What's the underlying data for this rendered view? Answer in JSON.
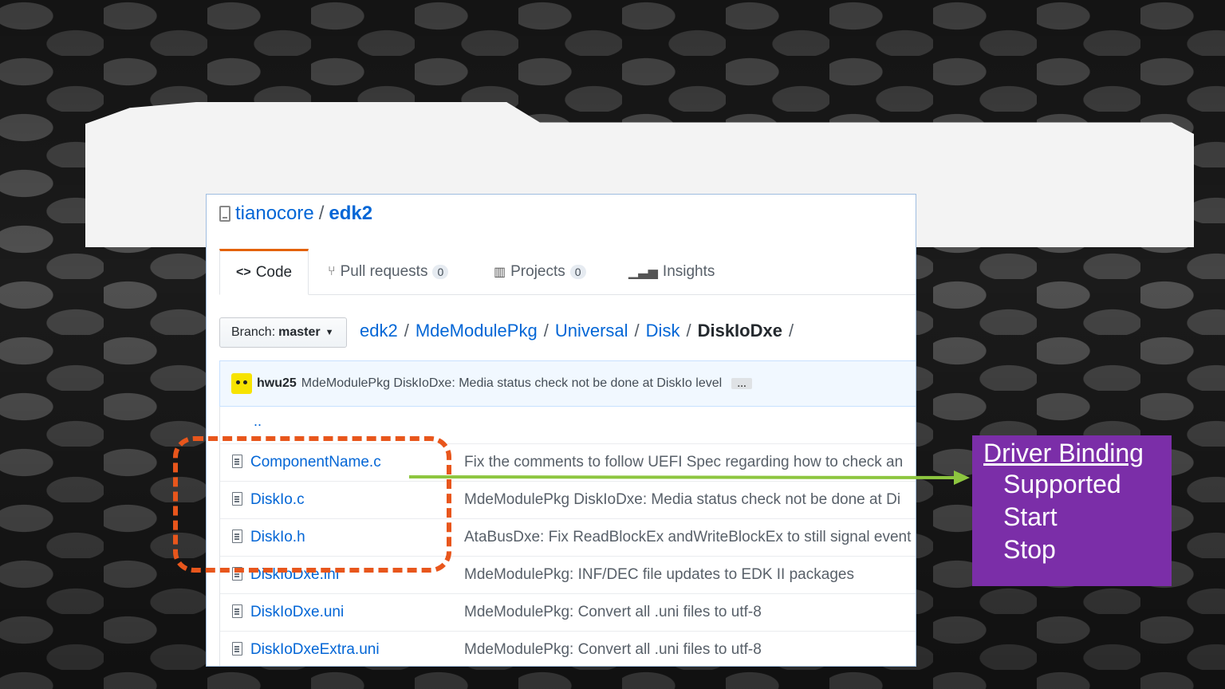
{
  "repo": {
    "owner": "tianocore",
    "name": "edk2",
    "separator": "/"
  },
  "tabs": [
    {
      "label": "Code",
      "icon": "code-icon"
    },
    {
      "label": "Pull requests",
      "count": "0",
      "icon": "pull-request-icon"
    },
    {
      "label": "Projects",
      "count": "0",
      "icon": "project-icon"
    },
    {
      "label": "Insights",
      "icon": "graph-icon"
    }
  ],
  "branch": {
    "prefix": "Branch:",
    "name": "master"
  },
  "breadcrumb": {
    "items": [
      "edk2",
      "MdeModulePkg",
      "Universal",
      "Disk"
    ],
    "current": "DiskIoDxe",
    "separator": "/"
  },
  "commit": {
    "author": "hwu25",
    "message": "MdeModulePkg DiskIoDxe: Media status check not be done at DiskIo level",
    "more": "…"
  },
  "files": {
    "up": "..",
    "rows": [
      {
        "name": "ComponentName.c",
        "message": "Fix the comments to follow UEFI Spec regarding how to check an"
      },
      {
        "name": "DiskIo.c",
        "message": "MdeModulePkg DiskIoDxe: Media status check not be done at Di"
      },
      {
        "name": "DiskIo.h",
        "message": "AtaBusDxe: Fix ReadBlockEx andWriteBlockEx to still signal event"
      },
      {
        "name": "DiskIoDxe.inf",
        "message": "MdeModulePkg: INF/DEC file updates to EDK II packages"
      },
      {
        "name": "DiskIoDxe.uni",
        "message": "MdeModulePkg: Convert all .uni files to utf-8"
      },
      {
        "name": "DiskIoDxeExtra.uni",
        "message": "MdeModulePkg: Convert all .uni files to utf-8"
      }
    ]
  },
  "callout": {
    "title": "Driver Binding ",
    "items": [
      "Supported",
      "Start",
      "Stop"
    ]
  },
  "colors": {
    "accent_orange": "#e8561c",
    "arrow_green": "#8dc63f",
    "callout_purple": "#7b2ea8",
    "link_blue": "#0366d6"
  }
}
